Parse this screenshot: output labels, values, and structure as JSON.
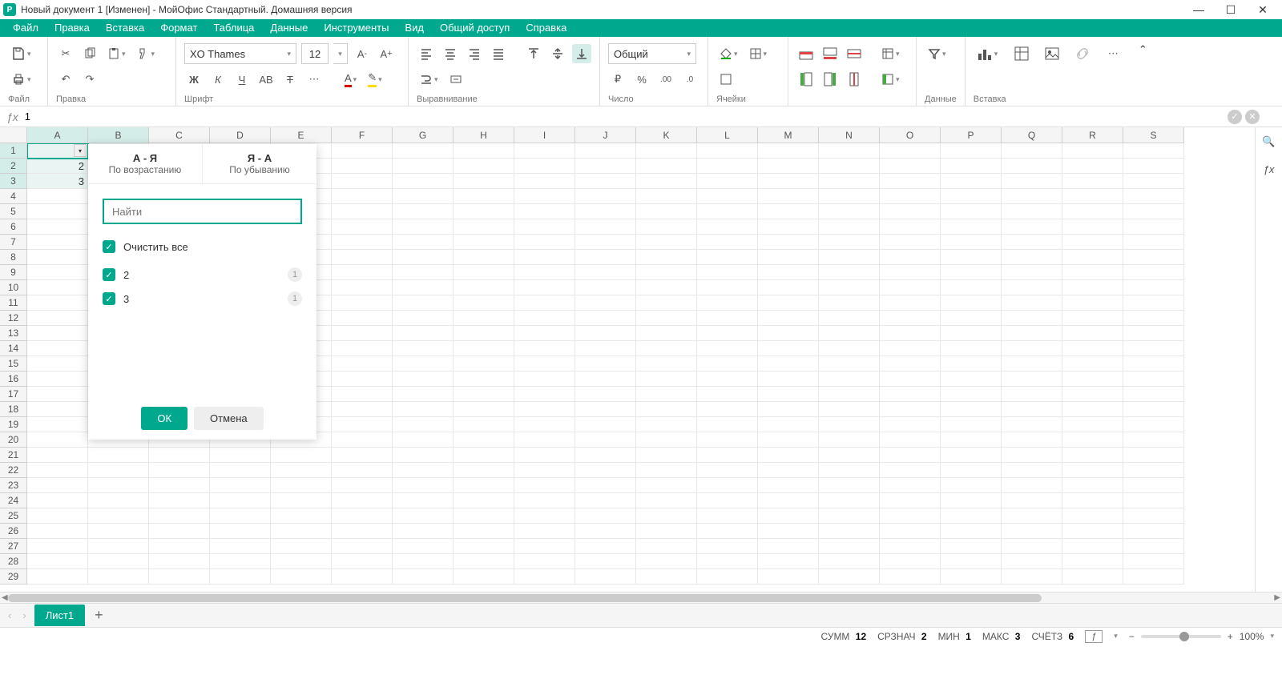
{
  "titlebar": {
    "title": "Новый документ 1 [Изменен] - МойОфис Стандартный. Домашняя версия"
  },
  "menu": [
    "Файл",
    "Правка",
    "Вставка",
    "Формат",
    "Таблица",
    "Данные",
    "Инструменты",
    "Вид",
    "Общий доступ",
    "Справка"
  ],
  "toolbar_groups": {
    "file": "Файл",
    "edit": "Правка",
    "font": "Шрифт",
    "align": "Выравнивание",
    "number": "Число",
    "cells": "Ячейки",
    "data": "Данные",
    "insert": "Вставка"
  },
  "font": {
    "name": "XO Thames",
    "size": "12"
  },
  "number_format": "Общий",
  "formula": {
    "value": "1"
  },
  "columns": [
    "A",
    "B",
    "C",
    "D",
    "E",
    "F",
    "G",
    "H",
    "I",
    "J",
    "K",
    "L",
    "M",
    "N",
    "O",
    "P",
    "Q",
    "R",
    "S"
  ],
  "row_count": 29,
  "cells": {
    "A1": "",
    "A2": "2",
    "A3": "3"
  },
  "selected_cols": [
    "A",
    "B"
  ],
  "selected_rows": [
    1,
    2,
    3
  ],
  "filter_popup": {
    "sort_asc_head": "А - Я",
    "sort_asc_sub": "По возрастанию",
    "sort_desc_head": "Я - А",
    "sort_desc_sub": "По убыванию",
    "search_placeholder": "Найти",
    "clear_all": "Очистить все",
    "items": [
      {
        "label": "2",
        "count": "1",
        "checked": true
      },
      {
        "label": "3",
        "count": "1",
        "checked": true
      }
    ],
    "ok": "ОК",
    "cancel": "Отмена"
  },
  "sheet_tab": "Лист1",
  "status": {
    "sum_label": "СУММ",
    "sum": "12",
    "avg_label": "СРЗНАЧ",
    "avg": "2",
    "min_label": "МИН",
    "min": "1",
    "max_label": "МАКС",
    "max": "3",
    "count_label": "СЧЁТЗ",
    "count": "6",
    "zoom": "100%"
  }
}
